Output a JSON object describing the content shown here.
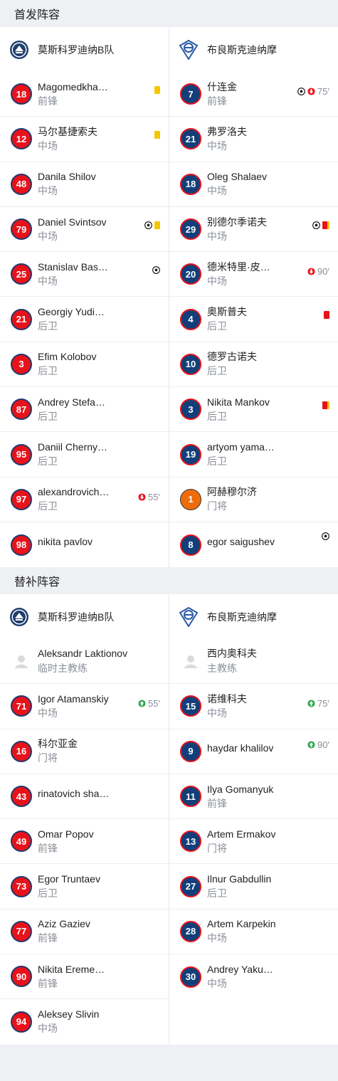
{
  "starting": {
    "title": "首发阵容",
    "home_team": "莫斯科罗迪纳B队",
    "away_team": "布良斯克迪纳摩",
    "home": [
      {
        "number": "18",
        "name": "Magomedkha…",
        "pos": "前锋",
        "events": [
          "yellow"
        ]
      },
      {
        "number": "12",
        "name": "马尔基捷索夫",
        "pos": "中场",
        "events": [
          "yellow"
        ]
      },
      {
        "number": "48",
        "name": "Danila Shilov",
        "pos": "中场",
        "events": []
      },
      {
        "number": "79",
        "name": "Daniel Svintsov",
        "pos": "中场",
        "events": [
          "goal",
          "yellow"
        ]
      },
      {
        "number": "25",
        "name": "Stanislav Bas…",
        "pos": "中场",
        "events": [
          "goal"
        ]
      },
      {
        "number": "21",
        "name": "Georgiy Yudi…",
        "pos": "后卫",
        "events": []
      },
      {
        "number": "3",
        "name": "Efim Kolobov",
        "pos": "后卫",
        "events": []
      },
      {
        "number": "87",
        "name": "Andrey Stefa…",
        "pos": "后卫",
        "events": []
      },
      {
        "number": "95",
        "name": "Daniil Cherny…",
        "pos": "后卫",
        "events": []
      },
      {
        "number": "97",
        "name": "alexandrovich…",
        "pos": "后卫",
        "events": [
          "sub-out"
        ],
        "minute": "55'"
      },
      {
        "number": "98",
        "name": "nikita pavlov",
        "pos": "",
        "events": []
      }
    ],
    "away": [
      {
        "number": "7",
        "name": "什连金",
        "pos": "前锋",
        "events": [
          "goal",
          "sub-out"
        ],
        "minute": "75'"
      },
      {
        "number": "21",
        "name": "弗罗洛夫",
        "pos": "中场",
        "events": []
      },
      {
        "number": "18",
        "name": "Oleg Shalaev",
        "pos": "中场",
        "events": []
      },
      {
        "number": "29",
        "name": "别德尔季诺夫",
        "pos": "中场",
        "events": [
          "goal",
          "second-yellow"
        ]
      },
      {
        "number": "20",
        "name": "德米特里·皮…",
        "pos": "中场",
        "events": [
          "sub-out"
        ],
        "minute": "90'"
      },
      {
        "number": "4",
        "name": "奥斯普夫",
        "pos": "后卫",
        "events": [
          "red"
        ]
      },
      {
        "number": "10",
        "name": "德罗古诺夫",
        "pos": "后卫",
        "events": []
      },
      {
        "number": "3",
        "name": "Nikita Mankov",
        "pos": "后卫",
        "events": [
          "second-yellow"
        ]
      },
      {
        "number": "19",
        "name": "artyom yama…",
        "pos": "后卫",
        "events": []
      },
      {
        "number": "1",
        "name": "阿赫穆尔济",
        "pos": "门将",
        "events": [],
        "keeper": true
      },
      {
        "number": "8",
        "name": "egor saigushev",
        "pos": "",
        "events": [
          "goal"
        ]
      }
    ]
  },
  "subs": {
    "title": "替补阵容",
    "home_team": "莫斯科罗迪纳B队",
    "away_team": "布良斯克迪纳摩",
    "home_coach": {
      "name": "Aleksandr Laktionov",
      "role": "临时主教练"
    },
    "away_coach": {
      "name": "西内奥科夫",
      "role": "主教练"
    },
    "home": [
      {
        "number": "71",
        "name": "Igor Atamanskiy",
        "pos": "中场",
        "events": [
          "sub-in"
        ],
        "minute": "55'"
      },
      {
        "number": "16",
        "name": "科尔亚金",
        "pos": "门将",
        "events": []
      },
      {
        "number": "43",
        "name": "rinatovich sha…",
        "pos": "",
        "events": []
      },
      {
        "number": "49",
        "name": "Omar Popov",
        "pos": "前锋",
        "events": []
      },
      {
        "number": "73",
        "name": "Egor Truntaev",
        "pos": "后卫",
        "events": []
      },
      {
        "number": "77",
        "name": "Aziz Gaziev",
        "pos": "前锋",
        "events": []
      },
      {
        "number": "90",
        "name": "Nikita Ereme…",
        "pos": "前锋",
        "events": []
      },
      {
        "number": "94",
        "name": "Aleksey Slivin",
        "pos": "中场",
        "events": []
      }
    ],
    "away": [
      {
        "number": "15",
        "name": "诺维科夫",
        "pos": "中场",
        "events": [
          "sub-in"
        ],
        "minute": "75'"
      },
      {
        "number": "9",
        "name": "haydar khalilov",
        "pos": "",
        "events": [
          "sub-in"
        ],
        "minute": "90'"
      },
      {
        "number": "11",
        "name": "Ilya Gomanyuk",
        "pos": "前锋",
        "events": []
      },
      {
        "number": "13",
        "name": "Artem Ermakov",
        "pos": "门将",
        "events": []
      },
      {
        "number": "27",
        "name": "Ilnur Gabdullin",
        "pos": "后卫",
        "events": []
      },
      {
        "number": "28",
        "name": "Artem Karpekin",
        "pos": "中场",
        "events": []
      },
      {
        "number": "30",
        "name": "Andrey Yaku…",
        "pos": "中场",
        "events": []
      }
    ]
  },
  "colors": {
    "home_number": "#e8121a",
    "away_number": "#123f7a",
    "keeper_number": "#ef6c0a",
    "yellow_card": "#f6c600",
    "red_card": "#e8121a",
    "sub_in": "#2fa84f",
    "sub_out": "#e8121a"
  },
  "icons": {
    "home_logo": "rodina-crest-icon",
    "away_logo": "dynamo-crest-icon",
    "goal": "football-icon",
    "sub-in": "sub-in-arrow-icon",
    "sub-out": "sub-out-arrow-icon",
    "coach": "coach-avatar-icon"
  }
}
